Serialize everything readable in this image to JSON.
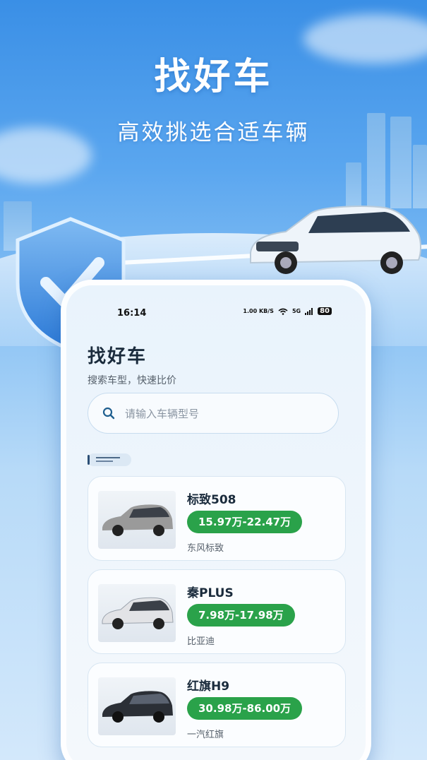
{
  "promo": {
    "title": "找好车",
    "subtitle": "高效挑选合适车辆"
  },
  "status_bar": {
    "time": "16:14",
    "network_speed": "1.00 KB/S",
    "signal": "5G",
    "battery": "80"
  },
  "app": {
    "title": "找好车",
    "subtitle": "搜索车型，快速比价"
  },
  "search": {
    "placeholder": "请输入车辆型号",
    "icon": "search-icon"
  },
  "cars": [
    {
      "name": "标致508",
      "price": "15.97万-22.47万",
      "brand": "东风标致",
      "color": "#9a9a9a"
    },
    {
      "name": "秦PLUS",
      "price": "7.98万-17.98万",
      "brand": "比亚迪",
      "color": "#e8e8ea"
    },
    {
      "name": "红旗H9",
      "price": "30.98万-86.00万",
      "brand": "一汽红旗",
      "color": "#2b2f36"
    }
  ],
  "colors": {
    "price_badge": "#2aa24a",
    "accent_blue": "#2f7fd8"
  }
}
